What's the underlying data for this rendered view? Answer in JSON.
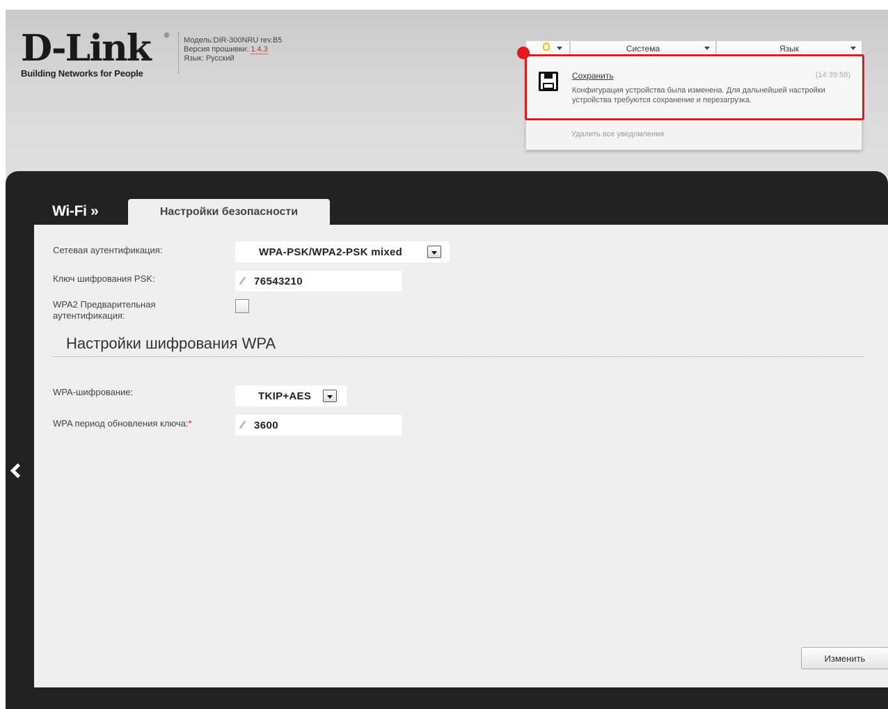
{
  "header": {
    "brand": "D-Link",
    "registered_mark": "®",
    "tagline": "Building Networks for People",
    "model_label": "Модель:",
    "model_value": "DIR-300NRU rev.B5",
    "firmware_label": "Версия прошивки:",
    "firmware_value": "1.4.3",
    "language_label": "Язык:",
    "language_value": "Русский"
  },
  "topbar": {
    "notify_icon": "lightbulb-icon",
    "system_label": "Система",
    "language_label": "Язык"
  },
  "notification": {
    "icon": "floppy-disk-icon",
    "title": "Сохранить",
    "time": "(14:39:58)",
    "text": "Конфигурация устройства была изменена. Для дальнейшей настройки устройства требуются сохранение и перезагрузка.",
    "clear_all": "Удалить все уведомления"
  },
  "nav": {
    "crumb": "Wi-Fi »",
    "active_tab": "Настройки безопасности"
  },
  "form": {
    "auth_label": "Сетевая аутентификация:",
    "auth_value": "WPA-PSK/WPA2-PSK mixed",
    "psk_label": "Ключ шифрования PSK:",
    "psk_value": "76543210",
    "preauth_label": "WPA2 Предварительная аутентификация:",
    "preauth_checked": false,
    "section_title": "Настройки шифрования WPA",
    "enc_label": "WPA-шифрование:",
    "enc_value": "TKIP+AES",
    "rekey_label": "WPA период обновления ключа:",
    "required_mark": "*",
    "rekey_value": "3600"
  },
  "actions": {
    "apply": "Изменить"
  },
  "colors": {
    "highlight": "#e0191e",
    "panel_dark": "#222222",
    "content_bg": "#efefef"
  }
}
